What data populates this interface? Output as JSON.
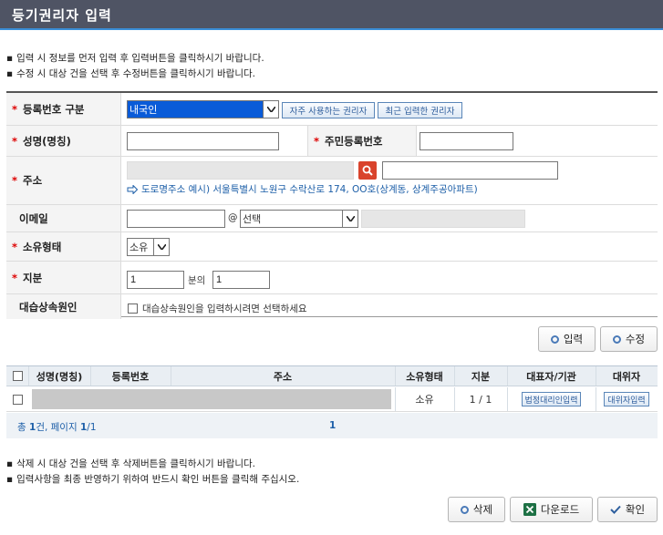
{
  "title": "등기권리자 입력",
  "notes_top": [
    "입력 시 정보를 먼저 입력 후 입력버튼을 클릭하시기 바랍니다.",
    "수정 시 대상 건을 선택 후 수정버튼을 클릭하시기 바랍니다."
  ],
  "form": {
    "reg_type_label": "등록번호 구분",
    "reg_type_value": "내국인",
    "frequent_btn": "자주 사용하는 권리자",
    "recent_btn": "최근 입력한 권리자",
    "name_label": "성명(명칭)",
    "name_value": "",
    "resident_label": "주민등록번호",
    "resident_value": "",
    "address_label": "주소",
    "address_value": "",
    "address_detail": "",
    "address_hint": "도로명주소 예시) 서울특별시 노원구 수락산로 174, OO호(상계동, 상계주공아파트)",
    "email_label": "이메일",
    "email_id": "",
    "email_at": "@",
    "email_domain_select": "선택",
    "email_domain_value": "",
    "ownership_label": "소유형태",
    "ownership_value": "소유",
    "share_label": "지분",
    "share_numerator": "1",
    "share_of": "분의",
    "share_denominator": "1",
    "successor_label": "대습상속원인",
    "successor_text": "대습상속원인을 입력하시려면 선택하세요",
    "successor_checked": false
  },
  "buttons": {
    "input": "입력",
    "modify": "수정",
    "delete": "삭제",
    "download": "다운로드",
    "confirm": "확인"
  },
  "table": {
    "headers": [
      "성명(명칭)",
      "등록번호",
      "주소",
      "소유형태",
      "지분",
      "대표자/기관",
      "대위자"
    ],
    "rows": [
      {
        "name": "",
        "reg_no": "",
        "address": "",
        "ownership": "소유",
        "share": "1 / 1",
        "rep_btn": "법정대리인입력",
        "subrogee_btn": "대위자입력"
      }
    ],
    "summary_total_prefix": "총 ",
    "summary_total_count": "1",
    "summary_total_suffix": "건, 페이지 ",
    "summary_page_current": "1",
    "summary_page_total": "/1",
    "page_number": "1"
  },
  "notes_bottom": [
    "삭제 시 대상 건을 선택 후 삭제버튼을 클릭하시기 바랍니다.",
    "입력사항을 최종 반영하기 위하여 반드시 확인 버튼을 클릭해 주십시오."
  ],
  "colors": {
    "titlebar": "#4f5464",
    "accent_blue": "#3b8ed6",
    "required": "#dd0000",
    "link": "#1d5fa8",
    "search_icon_bg": "#d9432c",
    "excel_green": "#1e7145"
  }
}
